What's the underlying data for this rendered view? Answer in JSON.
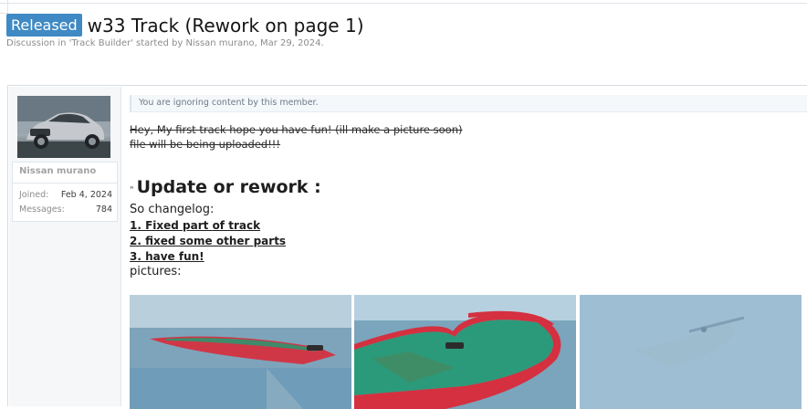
{
  "thread": {
    "prefix": "Released",
    "title": "w33 Track (Rework on page 1)",
    "desc_prefix": "Discussion in '",
    "forum": "Track Builder",
    "desc_mid": "' started by ",
    "starter": "Nissan murano",
    "desc_sep": ", ",
    "date": "Mar 29, 2024."
  },
  "user": {
    "name": "Nissan murano",
    "joined_label": "Joined:",
    "joined_value": "Feb 4, 2024",
    "messages_label": "Messages:",
    "messages_value": "784"
  },
  "post": {
    "ignored_notice": "You are ignoring content by this member.",
    "strike_line1": "Hey, My first track hope you have fun! (ill make a picture soon)",
    "strike_line2": "file will be being uploaded!!!",
    "quote_mark": "\"",
    "heading": "Update or rework :",
    "changelog": "So changelog:",
    "item1": "1. Fixed part of track",
    "item2": "2. fixed some other parts",
    "item3": "3. have fun!",
    "pictures": "pictures:"
  }
}
